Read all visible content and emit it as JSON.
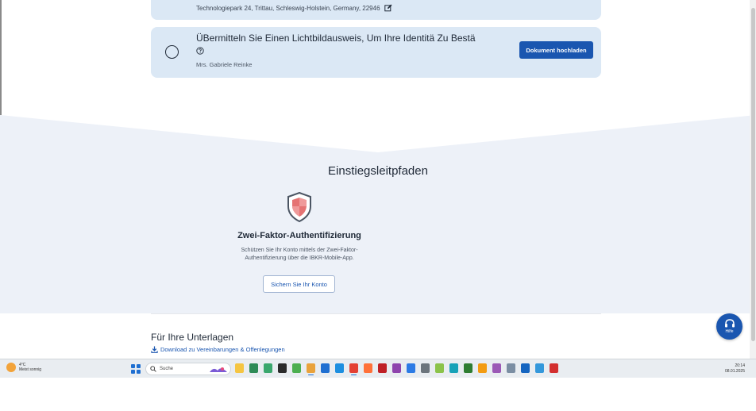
{
  "verification": {
    "address": "Technologiepark 24, Trittau, Schleswig-Holstein, Germany, 22946",
    "id_task": {
      "title": "ÜBermitteln Sie Einen Lichtbildausweis, Um Ihre Identitä Zu Bestä",
      "person": "Mrs. Gabriele Reinke",
      "button_label": "Dokument hochladen"
    }
  },
  "guides": {
    "title": "Einstiegsleitpfaden",
    "two_factor": {
      "title": "Zwei-Faktor-Authentifizierung",
      "description_line1": "Schützen Sie Ihr Konto mittels der Zwei-Faktor-",
      "description_line2": "Authentifizierung über die IBKR-Mobile-App.",
      "button_label": "Sichern Sie Ihr Konto"
    }
  },
  "records": {
    "title": "Für Ihre Unterlagen",
    "download_link": "Download zu Vereinbarungen & Offenlegungen"
  },
  "help_fab": {
    "label": "Hilfe"
  },
  "taskbar": {
    "weather_temp": "4°C",
    "weather_desc": "Meist sonnig",
    "search_label": "Suche",
    "time": "20:14",
    "date": "08.01.2025",
    "apps": [
      {
        "name": "file-explorer-icon",
        "color": "#f5c542"
      },
      {
        "name": "app-icon-green-1",
        "color": "#2e8b57"
      },
      {
        "name": "app-icon-green-2",
        "color": "#3aa76d"
      },
      {
        "name": "app-icon-dark",
        "color": "#2b2b2b"
      },
      {
        "name": "app-icon-green-3",
        "color": "#4caf50"
      },
      {
        "name": "app-icon-files",
        "color": "#e9a23b"
      },
      {
        "name": "mail-icon",
        "color": "#1f6fd1"
      },
      {
        "name": "edge-icon",
        "color": "#1d8fe0"
      },
      {
        "name": "chrome-icon",
        "color": "#e44134"
      },
      {
        "name": "firefox-icon",
        "color": "#ff7139"
      },
      {
        "name": "filezilla-icon",
        "color": "#bf2026"
      },
      {
        "name": "app-icon-purple",
        "color": "#8e44ad"
      },
      {
        "name": "app-icon-blue",
        "color": "#2c7be5"
      },
      {
        "name": "app-icon-gray",
        "color": "#6c757d"
      },
      {
        "name": "app-icon-lime",
        "color": "#8bc34a"
      },
      {
        "name": "app-icon-teal",
        "color": "#17a2b8"
      },
      {
        "name": "app-icon-leaf",
        "color": "#2e7d32"
      },
      {
        "name": "app-icon-orange",
        "color": "#f39c12"
      },
      {
        "name": "app-icon-multi",
        "color": "#9b59b6"
      },
      {
        "name": "app-icon-paint",
        "color": "#7b8ea3"
      },
      {
        "name": "app-icon-monitor",
        "color": "#1565c0"
      },
      {
        "name": "app-icon-globe",
        "color": "#3498db"
      },
      {
        "name": "acrobat-icon",
        "color": "#d32f2f"
      }
    ]
  }
}
